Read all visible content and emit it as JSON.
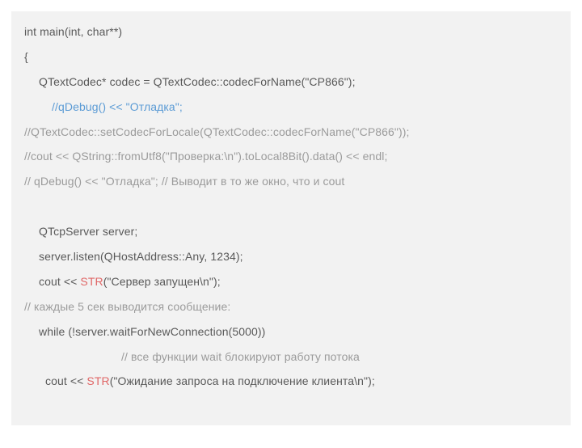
{
  "code": {
    "l1": "int main(int, char**)",
    "l2": "{",
    "l3": "QTextCodec* codec = QTextCodec::codecForName(\"CP866\");",
    "l4": "//qDebug() << \"Отладка\";",
    "l5": "//QTextCodec::setCodecForLocale(QTextCodec::codecForName(\"CP866\"));",
    "l6": "//cout << QString::fromUtf8(\"Проверка:\\n\").toLocal8Bit().data() << endl;",
    "l7": "// qDebug() << \"Отладка\"; // Выводит в то же окно, что и cout",
    "l9": "QTcpServer server;",
    "l10": "server.listen(QHostAddress::Any, 1234);",
    "l11a": "cout << ",
    "l11b": "STR",
    "l11c": "(\"Сервер запущен\\n\");",
    "l12": "// каждые 5 сек выводится сообщение:",
    "l13": "while (!server.waitForNewConnection(5000))",
    "l14": "// все функции wait блокируют работу потока",
    "l15a": "cout << ",
    "l15b": "STR",
    "l15c": "(\"Ожидание запроса на подключение клиента\\n\");"
  }
}
